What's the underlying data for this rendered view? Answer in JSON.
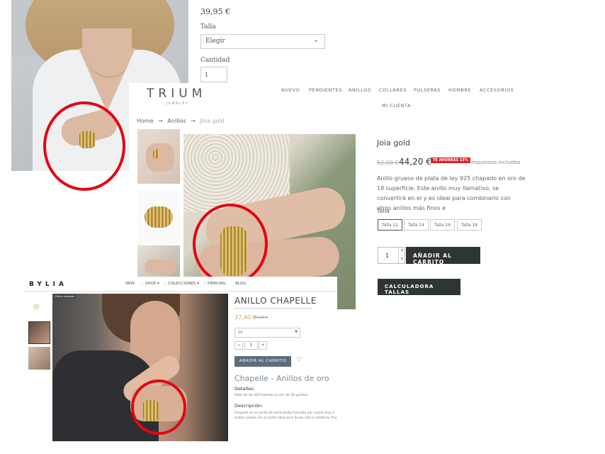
{
  "shot_a": {
    "price": "39,95 €",
    "talla_label": "Talla",
    "select_value": "Elegir",
    "cantidad_label": "Cantidad",
    "qty_value": "1"
  },
  "shot_b": {
    "logo": "TRIUM",
    "logo_sub": "JEWELRY",
    "nav": [
      "NUEVO",
      "PENDIENTES",
      "ANILLOS",
      "COLLARES",
      "PULSERAS",
      "HOMBRE",
      "ACCESORIOS",
      "MI CUENTA"
    ],
    "breadcrumb": [
      "Home",
      "→",
      "Anillos",
      "→",
      "Joia gold"
    ],
    "title": "Joia gold",
    "old_price": "52,00 €",
    "price": "44,20 €",
    "badge": "TE AHORRAS 15%",
    "tax": "Impuestos incluidos",
    "description": "Anillo grueso de plata de ley 925 chapado en oro de 18 superficie. Este anillo muy llamativo, se convertirá en el y es ideal para combinarlo con otros anillos más finos e",
    "talla_label": "Talla",
    "sizes": [
      "Talla 12",
      "Talla 14",
      "Talla 16",
      "Talla 18"
    ],
    "qty_value": "1",
    "add_to_cart": "AÑADIR AL CARRITO",
    "size_calc": "CALCULADORA TALLAS"
  },
  "shot_c": {
    "logo": "BYLIA",
    "nav": [
      "NEW",
      "SHOP ▾",
      "COLECCIONES ▾",
      "PIERCING",
      "BLOG"
    ],
    "tag": "Precio rebajado",
    "title": "ANILLO CHAPELLE",
    "price": "37,40 €",
    "old_price": "44,00 €",
    "select_value": "10",
    "qty_minus": "−",
    "qty_value": "1",
    "qty_plus": "+",
    "add_to_cart": "AÑADIR AL CARRITO",
    "subtitle": "Chapelle - Anillos de oro",
    "details_label": "Detalles:",
    "details": "Plata de ley 925 bañada en oro de 18 quilates",
    "desc_label": "Descripción:",
    "description": "Chapelle es un anillo de estilo bulky formado por cuatro aros o anillos unidos. Es un anillo ideal para llevar solo o combinar fino."
  },
  "colors": {
    "highlight_circle": "#e30613",
    "button_dark": "#2f3437",
    "button_slate": "#5d6e7a",
    "sale_badge": "#d9262a",
    "gold_price": "#c9a257"
  },
  "icons": [
    "chevron-down-icon",
    "heart-icon",
    "spinner-arrows-icon"
  ]
}
